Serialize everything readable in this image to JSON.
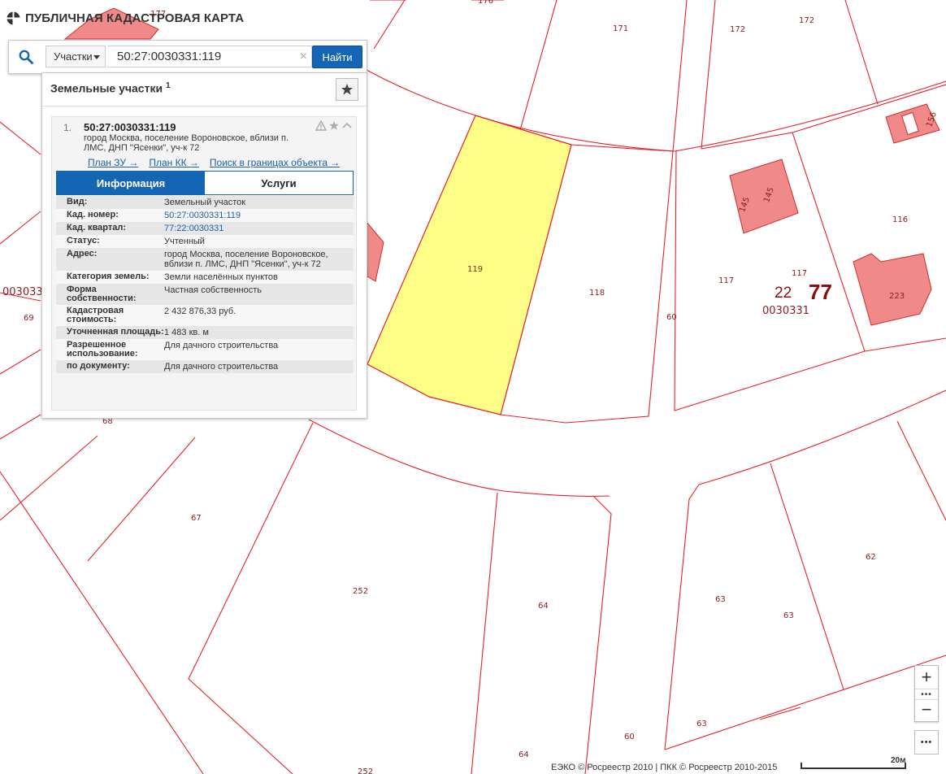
{
  "header": {
    "title": "ПУБЛИЧНАЯ КАДАСТРОВАЯ КАРТА"
  },
  "search": {
    "type_label": "Участки",
    "query": "50:27:0030331:119",
    "clear_symbol": "×",
    "find_label": "Найти"
  },
  "results": {
    "heading": "Земельные участки",
    "count": "1",
    "item": {
      "index": "1.",
      "cad_number": "50:27:0030331:119",
      "address": "город Москва, поселение Вороновское, вблизи п. ЛМС, ДНП \"Ясенки\", уч-к 72",
      "links": [
        "План ЗУ →",
        "План КК →",
        "Поиск в границах объекта →"
      ],
      "tabs": [
        "Информация",
        "Услуги"
      ],
      "rows": [
        {
          "key": "Вид:",
          "value": "Земельный участок"
        },
        {
          "key": "Кад. номер:",
          "value": "50:27:0030331:119"
        },
        {
          "key": "Кад. квартал:",
          "value": "77:22:0030331"
        },
        {
          "key": "Статус:",
          "value": "Учтенный"
        },
        {
          "key": "Адрес:",
          "value": "город Москва, поселение Вороновское, вблизи п. ЛМС, ДНП \"Ясенки\", уч-к 72"
        },
        {
          "key": "Категория земель:",
          "value": "Земли населённых пунктов"
        },
        {
          "key": "Форма собственности:",
          "value": "Частная собственность"
        },
        {
          "key": "Кадастровая стоимость:",
          "value": "2 432 876,33 руб."
        },
        {
          "key": "Уточненная площадь:",
          "value": "1 483 кв. м"
        },
        {
          "key": "Разрешенное использование:",
          "value": "Для дачного строительства"
        },
        {
          "key": "по документу:",
          "value": "Для дачного строительства"
        }
      ]
    }
  },
  "map": {
    "labels": [
      "119",
      "118",
      "117",
      "117",
      "116",
      "145",
      "145",
      "223",
      "156",
      "171",
      "172",
      "172",
      "60",
      "60",
      "60",
      "62",
      "63",
      "63",
      "63",
      "64",
      "64",
      "67",
      "68",
      "69",
      "252",
      "252",
      "0030331",
      "0030331",
      "22",
      "77",
      "176",
      "177"
    ],
    "colors": {
      "parcel_line": "#e8202a",
      "selected_fill": "#ffff88",
      "building_fill": "#f08a8a",
      "label": "#8a1d1d"
    }
  },
  "controls": {
    "zoom_in": "+",
    "zoom_out": "−",
    "dots": "•••",
    "more": "•••"
  },
  "footer": {
    "copyright": "ЕЭКО © Росреестр 2010 | ПКК © Росреестр 2010-2015",
    "scale": "20м"
  }
}
